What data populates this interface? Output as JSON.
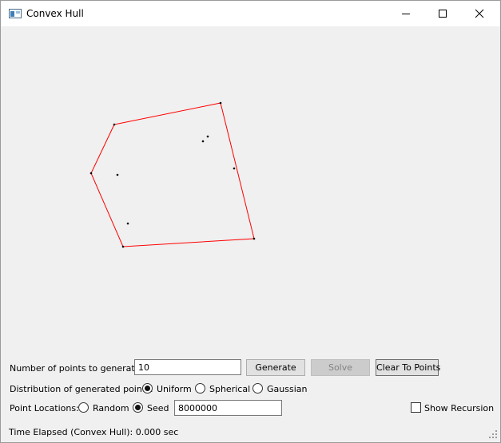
{
  "window": {
    "title": "Convex Hull"
  },
  "canvas": {
    "hull_color": "#ff0000",
    "point_color": "#000000"
  },
  "controls": {
    "num_points_label": "Number of points to generate:",
    "num_points_value": "10",
    "generate_label": "Generate",
    "solve_label": "Solve",
    "clear_label": "Clear To Points",
    "distribution_label": "Distribution of generated points:",
    "distribution_options": [
      "Uniform",
      "Spherical",
      "Gaussian"
    ],
    "distribution_selected": "Uniform",
    "location_label": "Point Locations:",
    "location_options": [
      "Random",
      "Seed"
    ],
    "location_selected": "Seed",
    "seed_value": "8000000",
    "show_recursion_label": "Show Recursion",
    "show_recursion_checked": false
  },
  "status": {
    "text": "Time Elapsed (Convex Hull): 0.000 sec"
  }
}
